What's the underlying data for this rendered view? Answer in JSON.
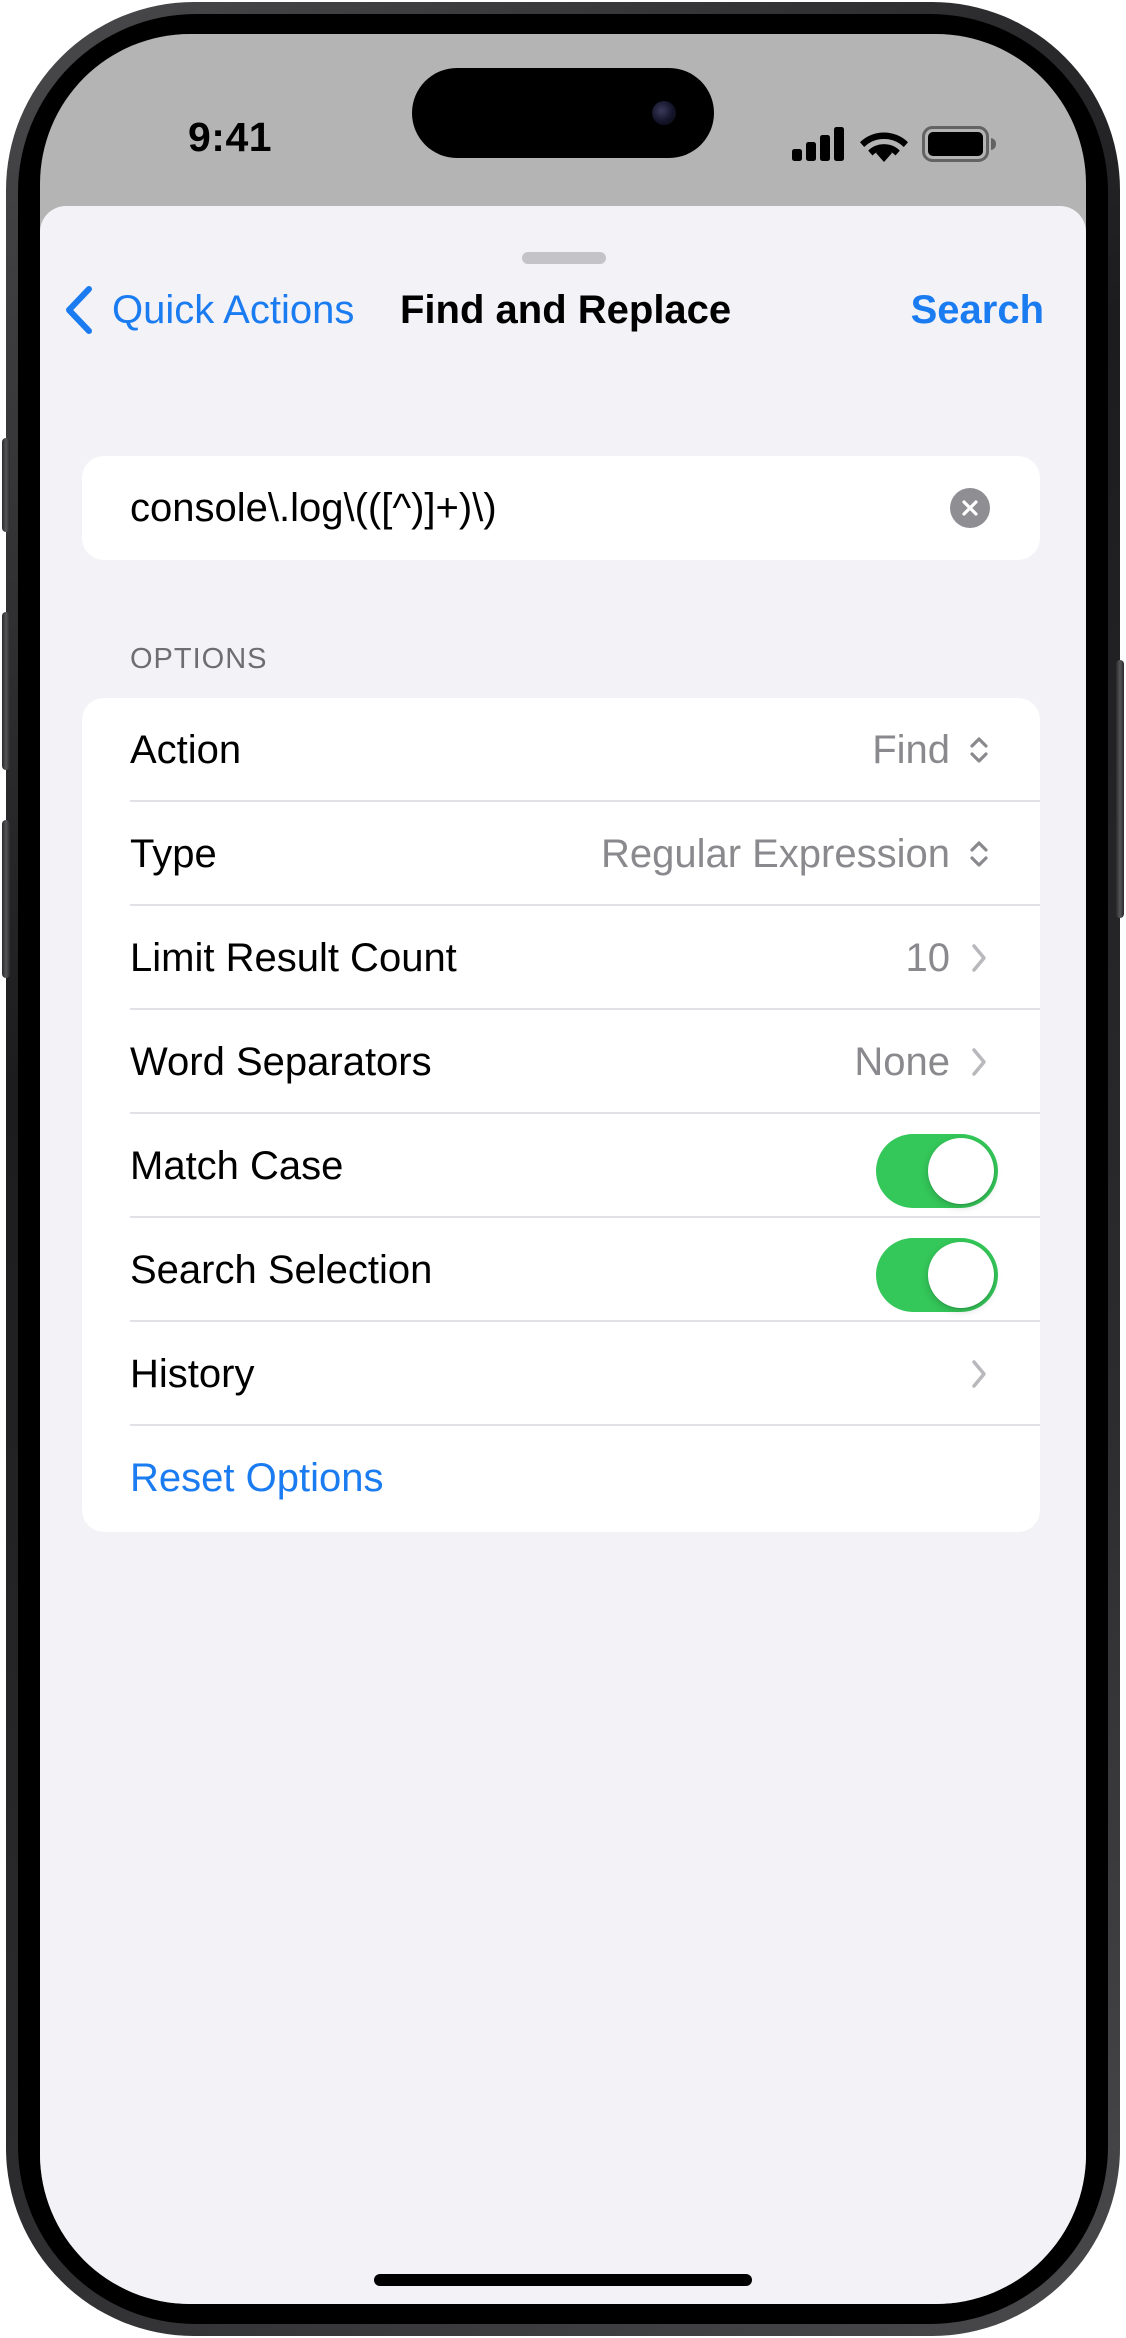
{
  "status_bar": {
    "time": "9:41",
    "icons": [
      "signal-icon",
      "wifi-icon",
      "battery-icon"
    ]
  },
  "nav": {
    "back_label": "Quick Actions",
    "title": "Find and Replace",
    "action_label": "Search"
  },
  "search": {
    "value": "console\\.log\\(([^)]+)\\)",
    "placeholder": ""
  },
  "options": {
    "header": "OPTIONS",
    "rows": [
      {
        "label": "Action",
        "value": "Find",
        "accessory": "chevron-up-down-icon"
      },
      {
        "label": "Type",
        "value": "Regular Expression",
        "accessory": "chevron-up-down-icon"
      },
      {
        "label": "Limit Result Count",
        "value": "10",
        "accessory": "chevron-right-icon"
      },
      {
        "label": "Word Separators",
        "value": "None",
        "accessory": "chevron-right-icon"
      },
      {
        "label": "Match Case",
        "toggle": true
      },
      {
        "label": "Search Selection",
        "toggle": true
      },
      {
        "label": "History",
        "accessory": "chevron-right-icon"
      }
    ],
    "reset_label": "Reset Options"
  },
  "colors": {
    "accent": "#1a7cf0",
    "toggle_on": "#34c759",
    "background": "#f2f2f7",
    "secondary_text": "#8a8a8e"
  }
}
